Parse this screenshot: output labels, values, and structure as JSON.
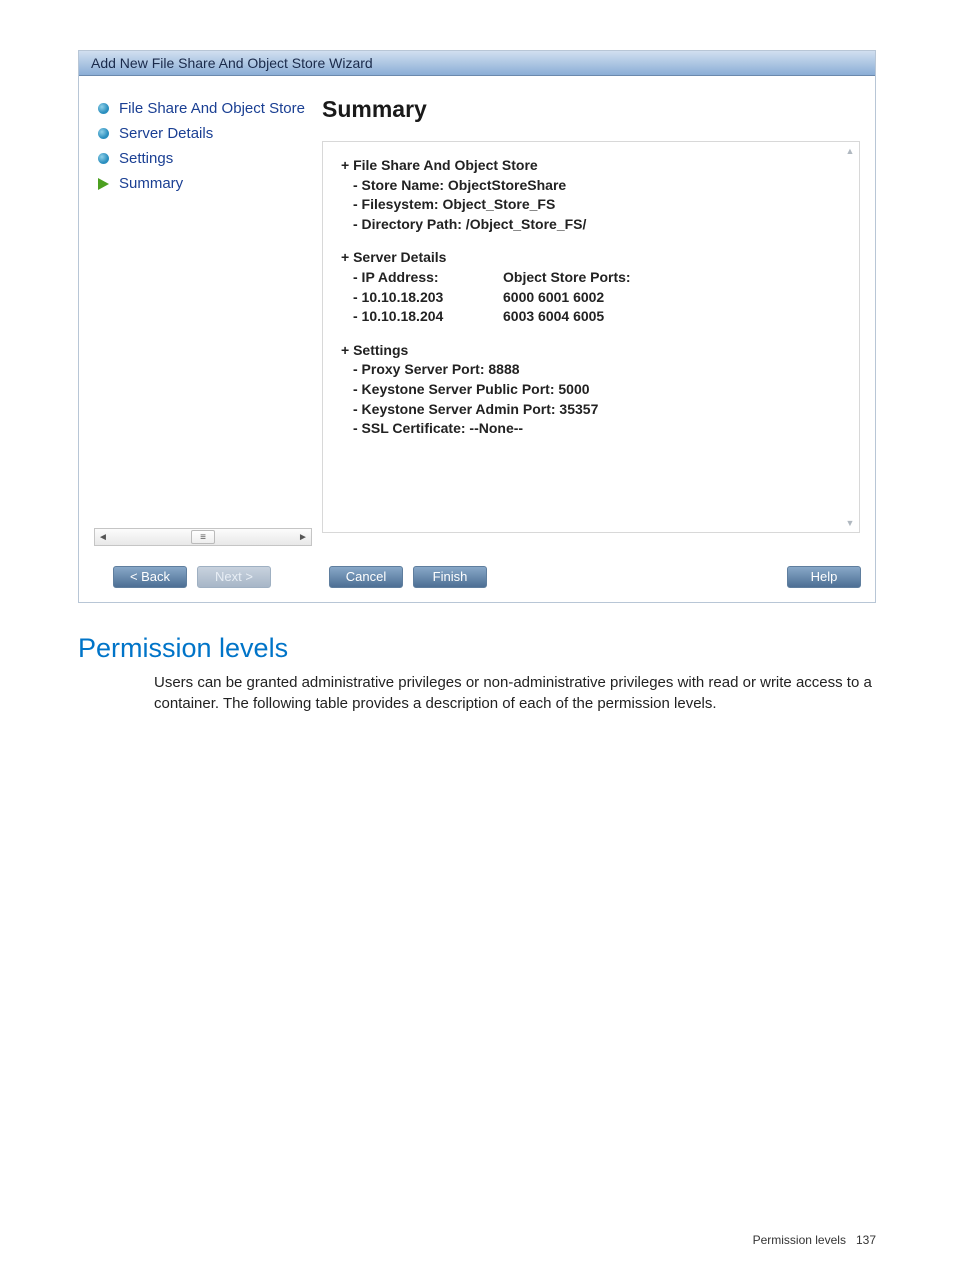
{
  "wizard": {
    "title": "Add New File Share And Object Store Wizard",
    "nav": [
      {
        "label": "File Share And Object Store",
        "state": "done"
      },
      {
        "label": "Server Details",
        "state": "done"
      },
      {
        "label": "Settings",
        "state": "done"
      },
      {
        "label": "Summary",
        "state": "current"
      }
    ],
    "content": {
      "heading": "Summary",
      "fileShare": {
        "title": "+ File Share And Object Store",
        "storeName": "- Store Name: ObjectStoreShare",
        "filesystem": "- Filesystem: Object_Store_FS",
        "dirPath": "- Directory Path: /Object_Store_FS/"
      },
      "serverDetails": {
        "title": "+ Server Details",
        "ipLabel": "- IP Address:",
        "portsLabel": "Object Store Ports:",
        "rows": [
          {
            "ip": "- 10.10.18.203",
            "ports": "6000 6001 6002"
          },
          {
            "ip": "- 10.10.18.204",
            "ports": "6003 6004 6005"
          }
        ]
      },
      "settings": {
        "title": "+ Settings",
        "proxy": "- Proxy Server Port: 8888",
        "keystonePublic": "- Keystone Server Public Port: 5000",
        "keystoneAdmin": "- Keystone Server Admin Port: 35357",
        "ssl": "- SSL Certificate: --None--"
      }
    },
    "buttons": {
      "back": "< Back",
      "next": "Next >",
      "cancel": "Cancel",
      "finish": "Finish",
      "help": "Help"
    }
  },
  "doc": {
    "heading": "Permission levels",
    "body": "Users can be granted administrative privileges or non-administrative privileges with read or write access to a container. The following table provides a description of each of the permission levels.",
    "footer_label": "Permission levels",
    "footer_page": "137"
  }
}
